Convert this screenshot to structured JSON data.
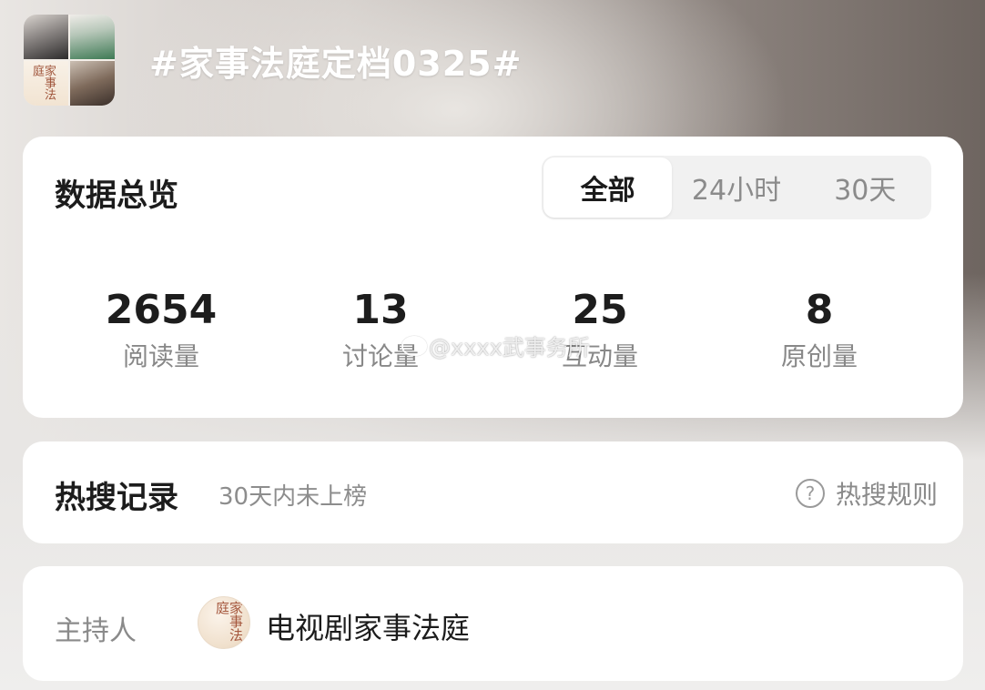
{
  "header": {
    "title": "#家事法庭定档0325#",
    "cover_calligraphy": "家事法庭"
  },
  "overview": {
    "title": "数据总览",
    "tabs": [
      {
        "label": "全部",
        "active": true
      },
      {
        "label": "24小时",
        "active": false
      },
      {
        "label": "30天",
        "active": false
      }
    ],
    "stats": [
      {
        "value": "2654",
        "label": "阅读量"
      },
      {
        "value": "13",
        "label": "讨论量"
      },
      {
        "value": "25",
        "label": "互动量"
      },
      {
        "value": "8",
        "label": "原创量"
      }
    ],
    "watermark": "@xxxx武事务所"
  },
  "hot_search": {
    "title": "热搜记录",
    "subtitle": "30天内未上榜",
    "rule_label": "热搜规则",
    "rule_icon": "question-circle-icon"
  },
  "host": {
    "label": "主持人",
    "name": "电视剧家事法庭",
    "avatar_calligraphy": "家事法庭"
  },
  "colors": {
    "card_bg": "#ffffff",
    "primary_text": "#1c1c1c",
    "secondary_text": "#8a8a8a",
    "segment_bg": "#f1f1f1"
  }
}
